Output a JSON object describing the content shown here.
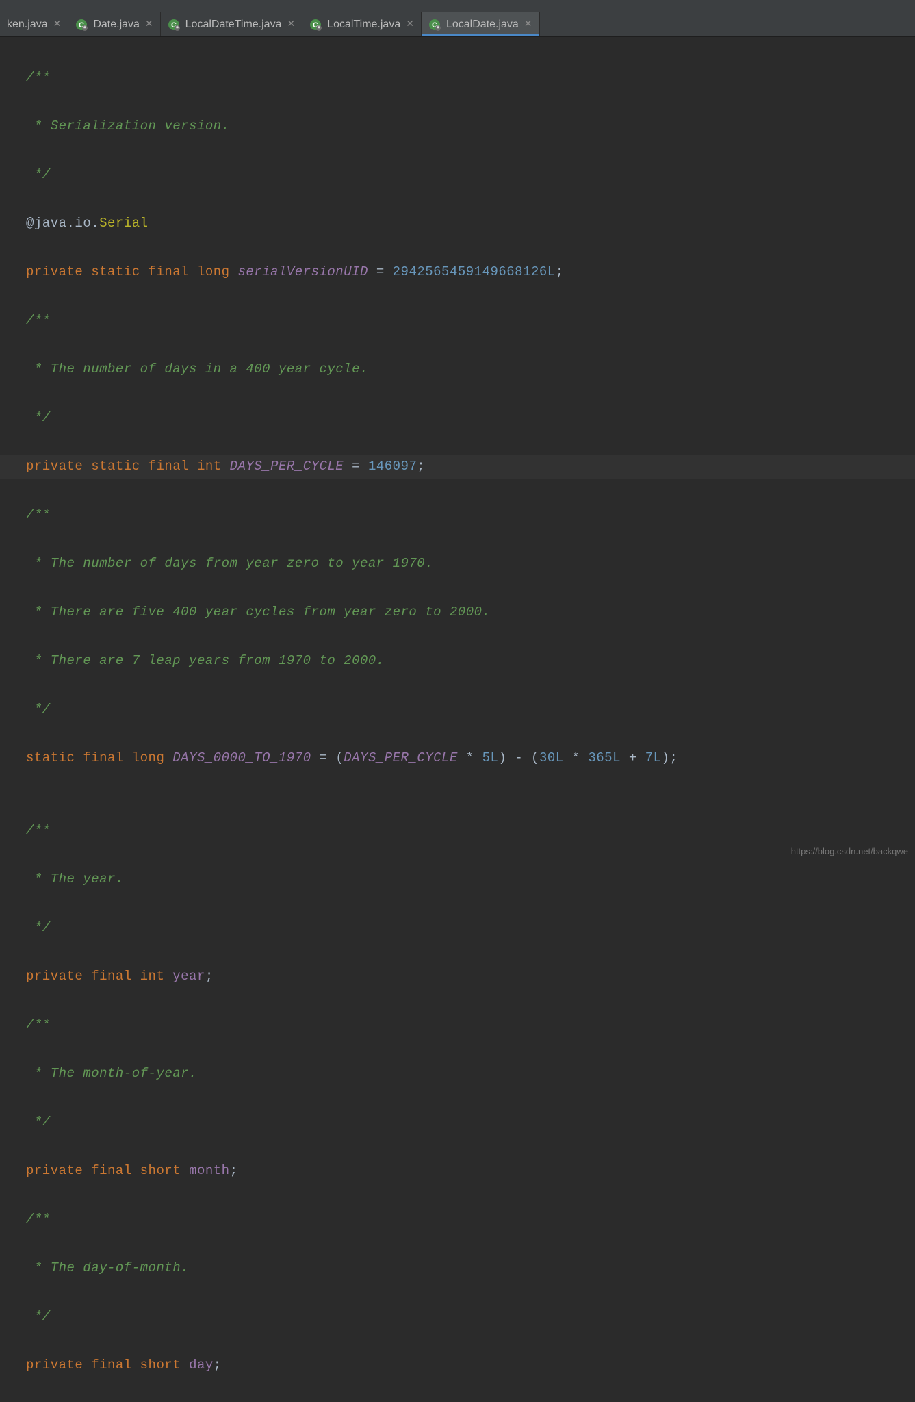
{
  "tabs": [
    {
      "label": "ken.java",
      "icon": "none",
      "active": false
    },
    {
      "label": "Date.java",
      "icon": "class",
      "active": false
    },
    {
      "label": "LocalDateTime.java",
      "icon": "class",
      "active": false
    },
    {
      "label": "LocalTime.java",
      "icon": "class",
      "active": false
    },
    {
      "label": "LocalDate.java",
      "icon": "class",
      "active": true
    }
  ],
  "code": {
    "l1": "/**",
    "l2": " * Serialization version.",
    "l3": " */",
    "l4_a": "@",
    "l4_b": "java.io.",
    "l4_c": "Serial",
    "l5_kw1": "private ",
    "l5_kw2": "static ",
    "l5_kw3": "final ",
    "l5_kw4": "long ",
    "l5_field": "serialVersionUID",
    "l5_eq": " = ",
    "l5_num": "2942565459149668126L",
    "l5_semi": ";",
    "l6": "/**",
    "l7": " * The number of days in a 400 year cycle.",
    "l8": " */",
    "l9_kw1": "private ",
    "l9_kw2": "static ",
    "l9_kw3": "final ",
    "l9_kw4": "int ",
    "l9_field": "DAYS_PER_CYCLE",
    "l9_eq": " = ",
    "l9_num": "146097",
    "l9_semi": ";",
    "l10": "/**",
    "l11": " * The number of days from year zero to year 1970.",
    "l12": " * There are five 400 year cycles from year zero to 2000.",
    "l13": " * There are 7 leap years from 1970 to 2000.",
    "l14": " */",
    "l15_kw1": "static ",
    "l15_kw2": "final ",
    "l15_kw3": "long ",
    "l15_field": "DAYS_0000_TO_1970",
    "l15_eq": " = ",
    "l15_p1": "(",
    "l15_ref": "DAYS_PER_CYCLE",
    "l15_times1": " * ",
    "l15_n5": "5L",
    "l15_p2": ")",
    "l15_minus": " - ",
    "l15_p3": "(",
    "l15_n30": "30L",
    "l15_times2": " * ",
    "l15_n365": "365L",
    "l15_plus": " + ",
    "l15_n7": "7L",
    "l15_p4": ")",
    "l15_semi": ";",
    "l16": "",
    "l17": "/**",
    "l18": " * The year.",
    "l19": " */",
    "l20_kw1": "private ",
    "l20_kw2": "final ",
    "l20_kw3": "int ",
    "l20_field": "year",
    "l20_semi": ";",
    "l21": "/**",
    "l22": " * The month-of-year.",
    "l23": " */",
    "l24_kw1": "private ",
    "l24_kw2": "final ",
    "l24_kw3": "short ",
    "l24_field": "month",
    "l24_semi": ";",
    "l25": "/**",
    "l26": " * The day-of-month.",
    "l27": " */",
    "l28_kw1": "private ",
    "l28_kw2": "final ",
    "l28_kw3": "short ",
    "l28_field": "day",
    "l28_semi": ";"
  },
  "watermark": "https://blog.csdn.net/backqwe"
}
